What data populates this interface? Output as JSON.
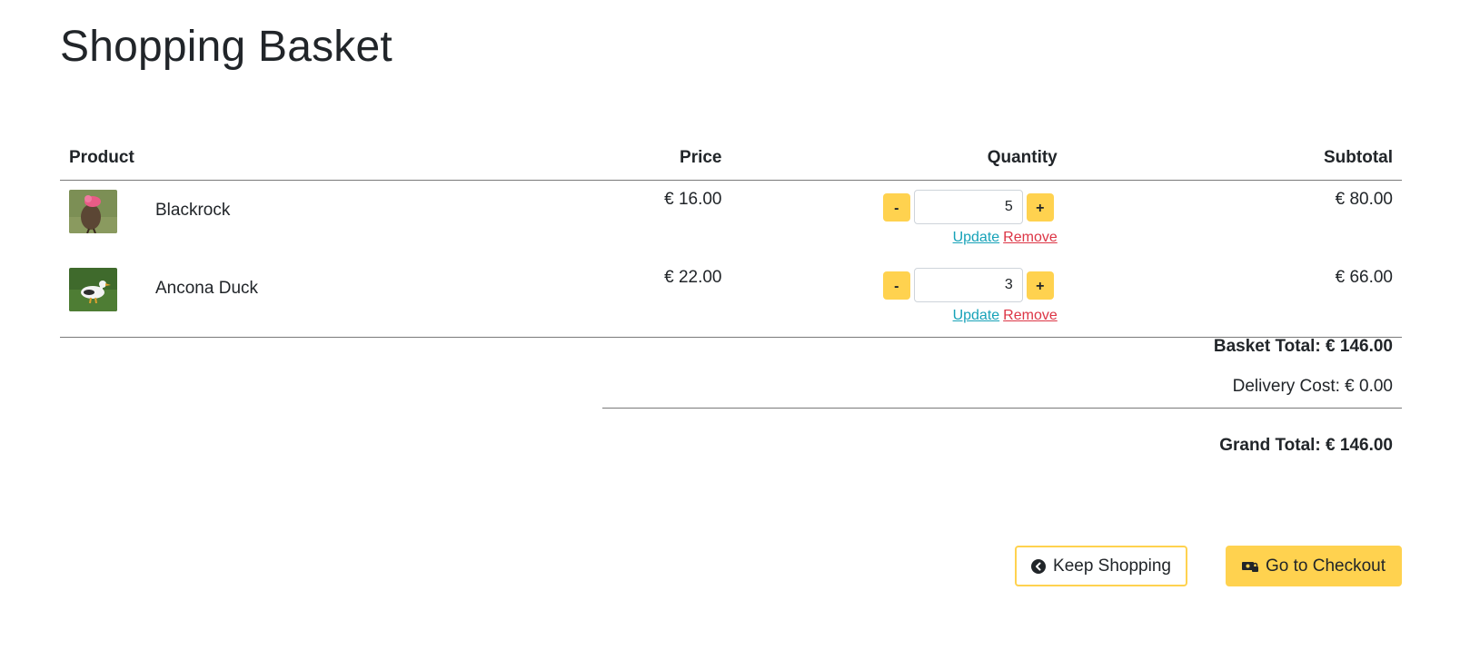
{
  "page": {
    "title": "Shopping Basket"
  },
  "table": {
    "headers": {
      "product": "Product",
      "price": "Price",
      "quantity": "Quantity",
      "subtotal": "Subtotal"
    },
    "items": [
      {
        "name": "Blackrock",
        "price": "€ 16.00",
        "quantity": "5",
        "subtotal": "€ 80.00",
        "minus_label": "-",
        "plus_label": "+",
        "update_label": "Update",
        "remove_label": "Remove",
        "thumb_icon": "chicken-photo"
      },
      {
        "name": "Ancona Duck",
        "price": "€ 22.00",
        "quantity": "3",
        "subtotal": "€ 66.00",
        "minus_label": "-",
        "plus_label": "+",
        "update_label": "Update",
        "remove_label": "Remove",
        "thumb_icon": "duck-photo"
      }
    ]
  },
  "totals": {
    "basket_total": "Basket Total: € 146.00",
    "delivery_cost": "Delivery Cost: € 0.00",
    "grand_total": "Grand Total: € 146.00"
  },
  "actions": {
    "keep_shopping": "Keep Shopping",
    "checkout": "Go to Checkout",
    "keep_shopping_icon": "chevron-left-circle-icon",
    "checkout_icon": "money-lock-icon"
  },
  "colors": {
    "accent": "#ffd24f",
    "link_update": "#17a2b8",
    "link_remove": "#dc3545",
    "text": "#212529"
  }
}
